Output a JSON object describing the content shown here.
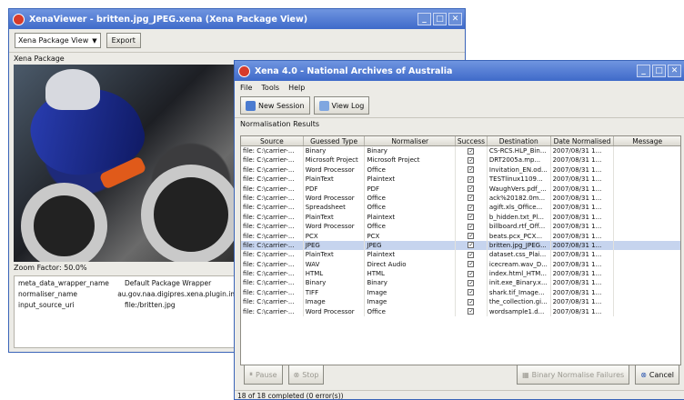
{
  "viewer": {
    "title": "XenaViewer - britten.jpg_JPEG.xena (Xena Package View)",
    "view_select": "Xena Package View",
    "export_label": "Export",
    "panel_label": "Xena Package",
    "zoom_text": "Zoom Factor: 50.0%",
    "properties": [
      {
        "key": "meta_data_wrapper_name",
        "value": "Default Package Wrapper"
      },
      {
        "key": "normaliser_name",
        "value": "au.gov.naa.digipres.xena.plugin.imag"
      },
      {
        "key": "input_source_uri",
        "value": "file:/britten.jpg"
      }
    ]
  },
  "main": {
    "title": "Xena 4.0 - National Archives of Australia",
    "menu": [
      "File",
      "Tools",
      "Help"
    ],
    "toolbar": {
      "new_session": "New Session",
      "view_log": "View Log"
    },
    "section_label": "Normalisation Results",
    "columns": [
      "Source",
      "Guessed Type",
      "Normaliser",
      "Success",
      "Destination",
      "Date Normalised",
      "Message"
    ],
    "rows": [
      {
        "source": "file: C:\\carrier-...",
        "type": "Binary",
        "normaliser": "Binary",
        "dest": "CS-RCS.HLP_Bin...",
        "date": "2007/08/31 1..."
      },
      {
        "source": "file: C:\\carrier-...",
        "type": "Microsoft Project",
        "normaliser": "Microsoft Project",
        "dest": "DRT2005a.mp...",
        "date": "2007/08/31 1..."
      },
      {
        "source": "file: C:\\carrier-...",
        "type": "Word Processor",
        "normaliser": "Office",
        "dest": "Invitation_EN.od...",
        "date": "2007/08/31 1..."
      },
      {
        "source": "file: C:\\carrier-...",
        "type": "PlainText",
        "normaliser": "Plaintext",
        "dest": "TESTlinux1109...",
        "date": "2007/08/31 1..."
      },
      {
        "source": "file: C:\\carrier-...",
        "type": "PDF",
        "normaliser": "PDF",
        "dest": "WaughVers.pdf_...",
        "date": "2007/08/31 1..."
      },
      {
        "source": "file: C:\\carrier-...",
        "type": "Word Processor",
        "normaliser": "Office",
        "dest": "ack%20182.0m...",
        "date": "2007/08/31 1..."
      },
      {
        "source": "file: C:\\carrier-...",
        "type": "Spreadsheet",
        "normaliser": "Office",
        "dest": "agift.xls_Office...",
        "date": "2007/08/31 1..."
      },
      {
        "source": "file: C:\\carrier-...",
        "type": "PlainText",
        "normaliser": "Plaintext",
        "dest": "b_hidden.txt_Pl...",
        "date": "2007/08/31 1..."
      },
      {
        "source": "file: C:\\carrier-...",
        "type": "Word Processor",
        "normaliser": "Office",
        "dest": "billboard.rtf_Off...",
        "date": "2007/08/31 1..."
      },
      {
        "source": "file: C:\\carrier-...",
        "type": "PCX",
        "normaliser": "PCX",
        "dest": "beats.pcx_PCX...",
        "date": "2007/08/31 1..."
      },
      {
        "source": "file: C:\\carrier-...",
        "type": "JPEG",
        "normaliser": "JPEG",
        "dest": "britten.jpg_JPEG...",
        "date": "2007/08/31 1..."
      },
      {
        "source": "file: C:\\carrier-...",
        "type": "PlainText",
        "normaliser": "Plaintext",
        "dest": "dataset.css_Plai...",
        "date": "2007/08/31 1..."
      },
      {
        "source": "file: C:\\carrier-...",
        "type": "WAV",
        "normaliser": "Direct Audio",
        "dest": "icecream.wav_D...",
        "date": "2007/08/31 1..."
      },
      {
        "source": "file: C:\\carrier-...",
        "type": "HTML",
        "normaliser": "HTML",
        "dest": "index.html_HTM...",
        "date": "2007/08/31 1..."
      },
      {
        "source": "file: C:\\carrier-...",
        "type": "Binary",
        "normaliser": "Binary",
        "dest": "init.exe_Binary.x...",
        "date": "2007/08/31 1..."
      },
      {
        "source": "file: C:\\carrier-...",
        "type": "TIFF",
        "normaliser": "Image",
        "dest": "shark.tif_Image...",
        "date": "2007/08/31 1..."
      },
      {
        "source": "file: C:\\carrier-...",
        "type": "Image",
        "normaliser": "Image",
        "dest": "the_collection.gi...",
        "date": "2007/08/31 1..."
      },
      {
        "source": "file: C:\\carrier-...",
        "type": "Word Processor",
        "normaliser": "Office",
        "dest": "wordsample1.d...",
        "date": "2007/08/31 1..."
      }
    ],
    "selected_row": 10,
    "buttons": {
      "pause": "Pause",
      "stop": "Stop",
      "binary_failures": "Binary Normalise Failures",
      "cancel": "Cancel"
    },
    "status": "18 of 18 completed (0 error(s))"
  }
}
